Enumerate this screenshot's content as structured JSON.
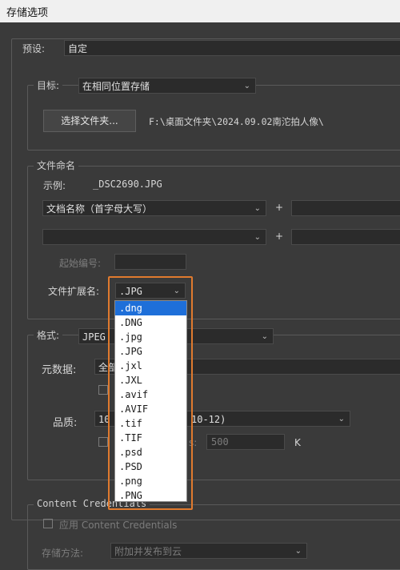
{
  "window": {
    "title": "存储选项"
  },
  "preset": {
    "label": "预设:",
    "value": "自定"
  },
  "target": {
    "legend": "目标:",
    "value": "在相同位置存储",
    "choose_button": "选择文件夹...",
    "path": "F:\\桌面文件夹\\2024.09.02南沱拍人像\\"
  },
  "naming": {
    "legend": "文件命名",
    "example_label": "示例:",
    "example_value": "_DSC2690.JPG",
    "field1": "文档名称（首字母大写）",
    "plus": "+",
    "start_label": "起始编号:",
    "ext_label": "文件扩展名:",
    "ext_value": ".JPG"
  },
  "ext_options": [
    ".dng",
    ".DNG",
    ".jpg",
    ".JPG",
    ".jxl",
    ".JXL",
    ".avif",
    ".AVIF",
    ".tif",
    ".TIF",
    ".psd",
    ".PSD",
    ".png",
    ".PNG"
  ],
  "format": {
    "label": "格式:",
    "value": "JPEG",
    "metadata_label": "元数据:",
    "metadata_value": "全部",
    "quality_label": "品质:",
    "quality_value": "10",
    "quality_suffix": "10-12)",
    "size_label": "s:",
    "size_value": "500",
    "size_unit": "K"
  },
  "credentials": {
    "legend": "Content Credentials",
    "apply_label": "应用 Content Credentials",
    "method_label": "存储方法:",
    "method_value": "附加并发布到云"
  }
}
